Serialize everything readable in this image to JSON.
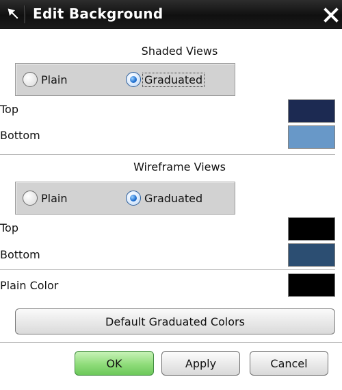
{
  "window": {
    "title": "Edit Background",
    "title_icon": "arrow-icon",
    "close_icon": "close-icon"
  },
  "shaded_views": {
    "heading": "Shaded Views",
    "options": [
      {
        "label": "Plain",
        "checked": false
      },
      {
        "label": "Graduated",
        "checked": true,
        "focused": true
      }
    ],
    "top_label": "Top",
    "top_color": "#1c2a52",
    "bottom_label": "Bottom",
    "bottom_color": "#6898c8"
  },
  "wireframe_views": {
    "heading": "Wireframe Views",
    "options": [
      {
        "label": "Plain",
        "checked": false
      },
      {
        "label": "Graduated",
        "checked": true
      }
    ],
    "top_label": "Top",
    "top_color": "#000000",
    "bottom_label": "Bottom",
    "bottom_color": "#2c4e72"
  },
  "plain_color": {
    "label": "Plain Color",
    "color": "#000000"
  },
  "buttons": {
    "default_graduated": "Default Graduated Colors",
    "ok": "OK",
    "apply": "Apply",
    "cancel": "Cancel"
  }
}
